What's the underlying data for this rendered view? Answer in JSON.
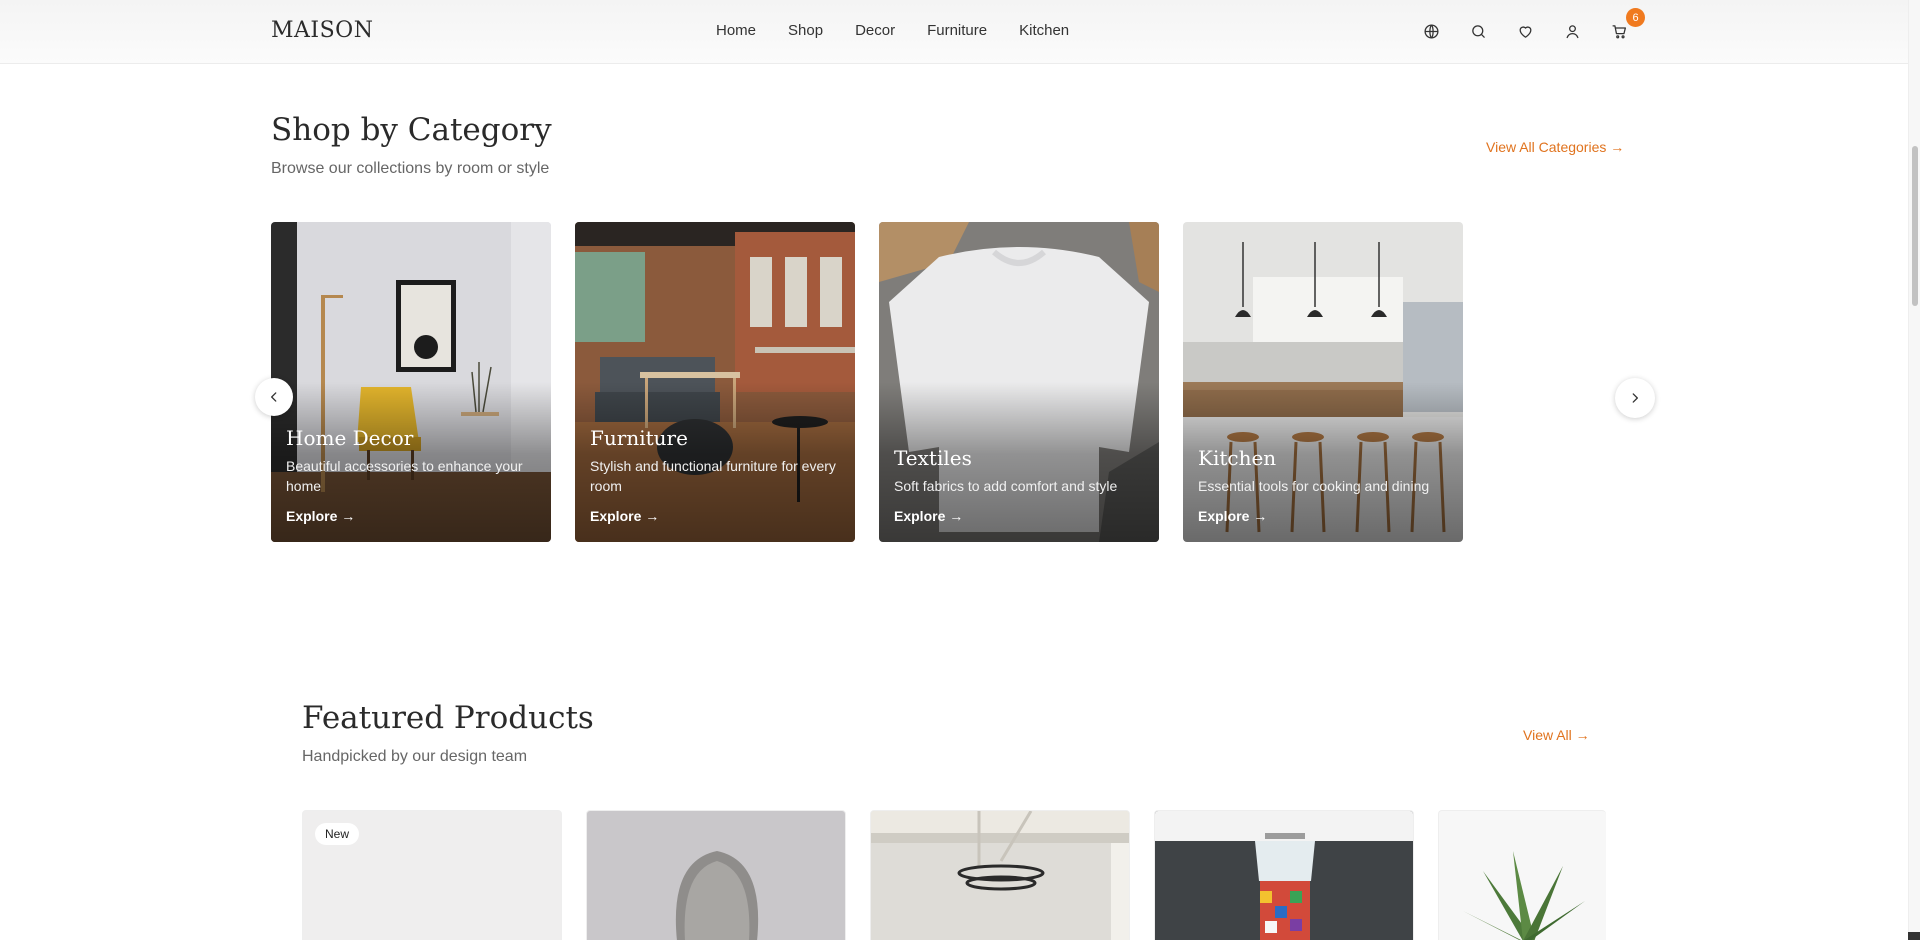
{
  "brand": "MAISON",
  "nav": [
    "Home",
    "Shop",
    "Decor",
    "Furniture",
    "Kitchen"
  ],
  "header_icons": [
    "globe-icon",
    "search-icon",
    "heart-icon",
    "user-icon",
    "cart-icon"
  ],
  "cart_count": "6",
  "accent_color": "#e0731e",
  "categories_section": {
    "title": "Shop by Category",
    "subtitle": "Browse our collections by room or style",
    "view_all": "View All Categories →",
    "cards": [
      {
        "title": "Home Decor",
        "desc": "Beautiful accessories to enhance your home",
        "cta": "Explore →"
      },
      {
        "title": "Furniture",
        "desc": "Stylish and functional furniture for every room",
        "cta": "Explore →"
      },
      {
        "title": "Textiles",
        "desc": "Soft fabrics to add comfort and style",
        "cta": "Explore →"
      },
      {
        "title": "Kitchen",
        "desc": "Essential tools for cooking and dining",
        "cta": "Explore →"
      }
    ]
  },
  "featured_section": {
    "title": "Featured Products",
    "subtitle": "Handpicked by our design team",
    "view_all": "View All →",
    "new_badge": "New"
  }
}
